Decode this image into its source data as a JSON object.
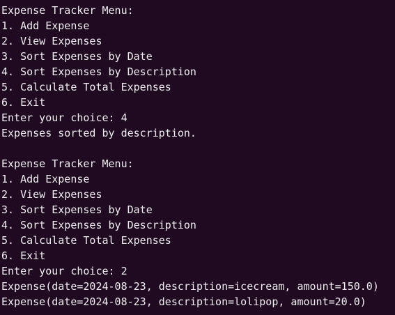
{
  "terminal": {
    "lines": [
      "Expense Tracker Menu:",
      "1. Add Expense",
      "2. View Expenses",
      "3. Sort Expenses by Date",
      "4. Sort Expenses by Description",
      "5. Calculate Total Expenses",
      "6. Exit",
      "Enter your choice: 4",
      "Expenses sorted by description.",
      "",
      "Expense Tracker Menu:",
      "1. Add Expense",
      "2. View Expenses",
      "3. Sort Expenses by Date",
      "4. Sort Expenses by Description",
      "5. Calculate Total Expenses",
      "6. Exit",
      "Enter your choice: 2",
      "Expense(date=2024-08-23, description=icecream, amount=150.0)",
      "Expense(date=2024-08-23, description=lolipop, amount=20.0)"
    ]
  },
  "colors": {
    "background": "#1f0a21",
    "text": "#efefef"
  }
}
